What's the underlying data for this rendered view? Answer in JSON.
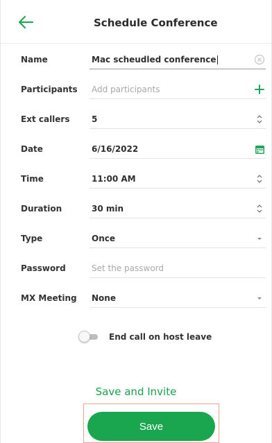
{
  "header": {
    "title": "Schedule Conference",
    "back_icon": "arrow-left-icon"
  },
  "form": {
    "name": {
      "label": "Name",
      "value": "Mac scheudled conference",
      "trail_icon": "clear-circle-icon"
    },
    "participants": {
      "label": "Participants",
      "placeholder": "Add participants",
      "trail_icon": "plus-icon"
    },
    "ext_callers": {
      "label": "Ext callers",
      "value": "5",
      "trail_icon": "stepper-icon"
    },
    "date": {
      "label": "Date",
      "value": "6/16/2022",
      "trail_icon": "calendar-icon"
    },
    "time": {
      "label": "Time",
      "value": "11:00 AM",
      "trail_icon": "stepper-icon"
    },
    "duration": {
      "label": "Duration",
      "value": "30 min",
      "trail_icon": "stepper-icon"
    },
    "type": {
      "label": "Type",
      "value": "Once",
      "trail_icon": "dropdown-arrow-icon"
    },
    "password": {
      "label": "Password",
      "placeholder": "Set the password"
    },
    "mx_meeting": {
      "label": "MX Meeting",
      "value": "None",
      "trail_icon": "dropdown-arrow-icon"
    }
  },
  "toggle": {
    "label": "End call on host leave",
    "on": false
  },
  "actions": {
    "save_invite_label": "Save and Invite",
    "save_label": "Save"
  },
  "colors": {
    "accent": "#1aa64e",
    "accent_text": "#17a34a",
    "highlight_border": "#f0a090"
  }
}
